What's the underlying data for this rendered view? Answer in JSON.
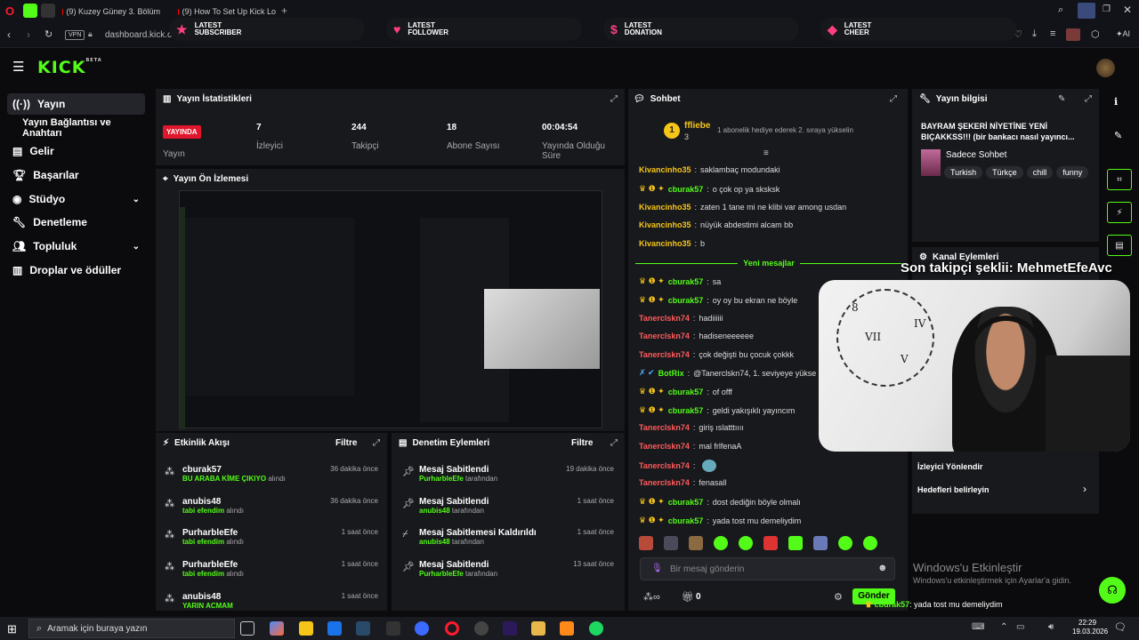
{
  "browser": {
    "tabs": [
      {
        "label": "(9) Kuzey Güney 3. Bölüm"
      },
      {
        "label": "(9) How To Set Up Kick Lo"
      }
    ],
    "vpn": "VPN",
    "url": "dashboard.kick.co",
    "ai_label": "AI"
  },
  "alerts": [
    {
      "line1": "LATEST",
      "line2": "SUBSCRIBER"
    },
    {
      "line1": "LATEST",
      "line2": "FOLLOWER"
    },
    {
      "line1": "LATEST",
      "line2": "DONATION"
    },
    {
      "line1": "LATEST",
      "line2": "CHEER"
    }
  ],
  "kick": {
    "logo": "KICK",
    "logo_sup": "BETA"
  },
  "sidebar": {
    "items": [
      {
        "label": "Yayın"
      },
      {
        "label": "Yayın Bağlantısı ve Anahtarı"
      },
      {
        "label": "Gelir"
      },
      {
        "label": "Başarılar"
      },
      {
        "label": "Stüdyo"
      },
      {
        "label": "Denetleme"
      },
      {
        "label": "Topluluk"
      },
      {
        "label": "Droplar ve ödüller"
      }
    ]
  },
  "stats": {
    "title": "Yayın İstatistikleri",
    "live_badge": "YAYINDA",
    "live_label": "Yayın",
    "items": [
      {
        "value": "7",
        "label": "İzleyici"
      },
      {
        "value": "244",
        "label": "Takipçi"
      },
      {
        "value": "18",
        "label": "Abone Sayısı"
      },
      {
        "value": "00:04:54",
        "label": "Yayında Olduğu Süre"
      }
    ]
  },
  "preview": {
    "title": "Yayın Ön İzlemesi"
  },
  "activity": {
    "title": "Etkinlik Akışı",
    "filter": "Filtre",
    "items": [
      {
        "user": "cburak57",
        "sub": "BU ARABA KİME ÇIKIYO",
        "suffix": "alındı",
        "time": "36 dakika önce"
      },
      {
        "user": "anubis48",
        "sub": "tabi efendim",
        "suffix": "alındı",
        "time": "36 dakika önce"
      },
      {
        "user": "PurharbleEfe",
        "sub": "tabi efendim",
        "suffix": "alındı",
        "time": "1 saat önce"
      },
      {
        "user": "PurharbleEfe",
        "sub": "tabi efendim",
        "suffix": "alındı",
        "time": "1 saat önce"
      },
      {
        "user": "anubis48",
        "sub": "YARIN ACMAM",
        "suffix": "",
        "time": "1 saat önce"
      }
    ]
  },
  "moderation": {
    "title": "Denetim Eylemleri",
    "filter": "Filtre",
    "items": [
      {
        "action": "Mesaj Sabitlendi",
        "user": "PurharbleEfe",
        "suffix": "tarafından",
        "time": "19 dakika önce"
      },
      {
        "action": "Mesaj Sabitlendi",
        "user": "anubis48",
        "suffix": "tarafından",
        "time": "1 saat önce"
      },
      {
        "action": "Mesaj Sabitlemesi Kaldırıldı",
        "user": "anubis48",
        "suffix": "tarafından",
        "time": "1 saat önce"
      },
      {
        "action": "Mesaj Sabitlendi",
        "user": "PurharbleEfe",
        "suffix": "tarafından",
        "time": "13 saat önce"
      }
    ]
  },
  "chat": {
    "title": "Sohbet",
    "pinned_user": "ffliebe",
    "pinned_count": "3",
    "pinned_note": "1 abonelik hediye ederek 2. sıraya yükselin",
    "new_messages": "Yeni mesajlar",
    "messages": [
      {
        "user": "Kivancinho35",
        "text": "saklambaç modundaki",
        "color": "y",
        "badges": ""
      },
      {
        "user": "cburak57",
        "text": "o çok op ya sksksk",
        "color": "g",
        "badges": "crown"
      },
      {
        "user": "Kivancinho35",
        "text": "zaten 1 tane mi ne klibi var among usdan",
        "color": "y",
        "badges": ""
      },
      {
        "user": "Kivancinho35",
        "text": "nüyük abdestimi alcam bb",
        "color": "y",
        "badges": ""
      },
      {
        "user": "Kivancinho35",
        "text": "b",
        "color": "y",
        "badges": ""
      },
      {
        "user": "cburak57",
        "text": "sa",
        "color": "g",
        "badges": "crown"
      },
      {
        "user": "cburak57",
        "text": "oy oy bu ekran ne böyle",
        "color": "g",
        "badges": "crown"
      },
      {
        "user": "Tanerclskn74",
        "text": "hadiiiiii",
        "color": "r",
        "badges": ""
      },
      {
        "user": "Tanerclskn74",
        "text": "hadiseneeeeee",
        "color": "r",
        "badges": ""
      },
      {
        "user": "Tanerclskn74",
        "text": "çok değişti bu çocuk çokkk",
        "color": "r",
        "badges": ""
      },
      {
        "user": "BotRix",
        "text": "@Tanerclskn74, 1. seviyeye yükse",
        "color": "g",
        "badges": "bot"
      },
      {
        "user": "cburak57",
        "text": "of offf",
        "color": "g",
        "badges": "crown"
      },
      {
        "user": "cburak57",
        "text": "geldi yakışıklı yayıncım",
        "color": "g",
        "badges": "crown"
      },
      {
        "user": "Tanerclskn74",
        "text": "giriş ıslatttıııı",
        "color": "r",
        "badges": ""
      },
      {
        "user": "Tanerclskn74",
        "text": "mal frlfenaA",
        "color": "r",
        "badges": ""
      },
      {
        "user": "Tanerclskn74",
        "text": "",
        "color": "r",
        "badges": ""
      },
      {
        "user": "Tanerclskn74",
        "text": "fenasall",
        "color": "r",
        "badges": ""
      },
      {
        "user": "cburak57",
        "text": "dost dediğin böyle olmalı",
        "color": "g",
        "badges": "crown"
      },
      {
        "user": "cburak57",
        "text": "yada tost mu demeliydim",
        "color": "g",
        "badges": "crown"
      }
    ],
    "input_placeholder": "Bir mesaj gönderin",
    "send": "Gönder",
    "points": "0"
  },
  "streaminfo": {
    "title": "Yayın bilgisi",
    "stream_title": "BAYRAM ŞEKERİ NİYETİNE YENİ BIÇAKKSS!!! (bir bankacı nasıl yayıncı...",
    "category": "Sadece Sohbet",
    "tags": [
      "Turkish",
      "Türkçe",
      "chill",
      "funny"
    ]
  },
  "channel_actions": {
    "title": "Kanal Eylemleri",
    "raid": "İzleyici Yönlendir",
    "goals": "Hedefleri belirleyin"
  },
  "overlay": {
    "follower_text": "Son takipçi şeklii: MehmetEfeAvc",
    "bottom_chat_user": "cburak57",
    "bottom_chat_text": ": yada tost mu demeliydim"
  },
  "windows": {
    "activate_title": "Windows'u Etkinleştir",
    "activate_sub": "Windows'u etkinleştirmek için Ayarlar'a gidin.",
    "search": "Aramak için buraya yazın",
    "time": "22:29",
    "date": "19.03.2026"
  }
}
